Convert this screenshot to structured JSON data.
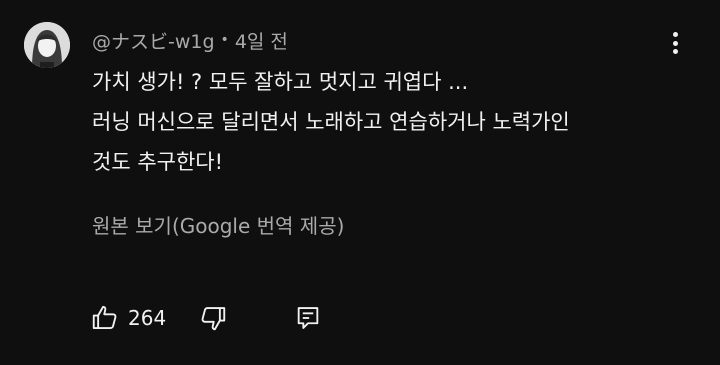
{
  "comment": {
    "author": "@ナスビ-w1g",
    "separator": "•",
    "time_ago": "4일 전",
    "text_lines": [
      "가치 생가! ? 모두 잘하고 멋지고 귀엽다 ...",
      "러닝 머신으로 달리면서 노래하고 연습하거나 노력가인",
      "것도 추구한다!"
    ],
    "translate_label": "원본 보기(Google 번역 제공)",
    "like_count": "264"
  },
  "icons": {
    "avatar": "avatar-image",
    "menu": "more-vert-icon",
    "like": "thumb-up-icon",
    "dislike": "thumb-down-icon",
    "reply": "reply-comment-icon"
  },
  "colors": {
    "background": "#0f0f0f",
    "primary_text": "#f1f1f1",
    "secondary_text": "#aaaaaa"
  }
}
